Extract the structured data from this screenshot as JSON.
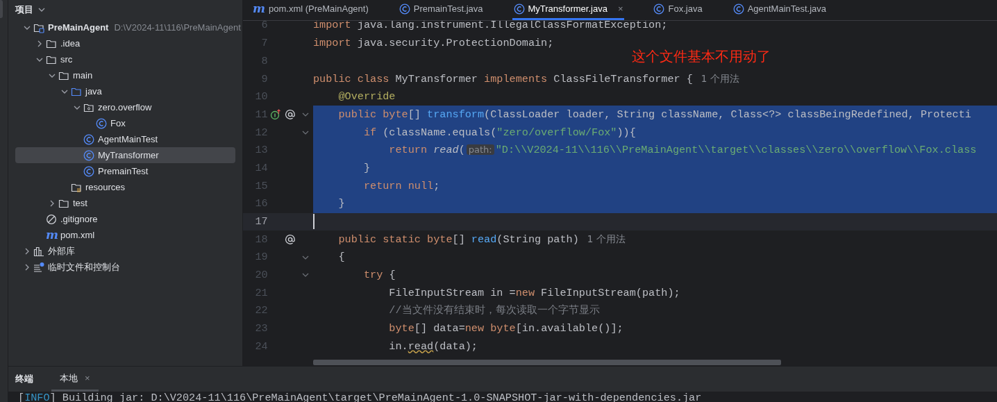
{
  "project_panel": {
    "title": "项目",
    "tree": [
      {
        "label": "PreMainAgent",
        "kind": "project",
        "path": "D:\\V2024-11\\116\\PreMainAgent",
        "expanded": true,
        "selected": false,
        "children": [
          {
            "label": ".idea",
            "kind": "folder",
            "expanded": false,
            "selected": false
          },
          {
            "label": "src",
            "kind": "folder",
            "expanded": true,
            "selected": false,
            "children": [
              {
                "label": "main",
                "kind": "folder",
                "expanded": true,
                "selected": false,
                "children": [
                  {
                    "label": "java",
                    "kind": "source",
                    "expanded": true,
                    "selected": false,
                    "children": [
                      {
                        "label": "zero.overflow",
                        "kind": "package",
                        "expanded": true,
                        "selected": false,
                        "children": [
                          {
                            "label": "Fox",
                            "kind": "class",
                            "selected": false
                          }
                        ]
                      },
                      {
                        "label": "AgentMainTest",
                        "kind": "class",
                        "selected": false
                      },
                      {
                        "label": "MyTransformer",
                        "kind": "class",
                        "selected": true
                      },
                      {
                        "label": "PremainTest",
                        "kind": "class",
                        "selected": false
                      }
                    ]
                  },
                  {
                    "label": "resources",
                    "kind": "resources",
                    "selected": false
                  }
                ]
              },
              {
                "label": "test",
                "kind": "folder",
                "expanded": false,
                "selected": false
              }
            ]
          },
          {
            "label": ".gitignore",
            "kind": "ignore",
            "selected": false
          },
          {
            "label": "pom.xml",
            "kind": "maven",
            "badge": "m",
            "selected": false
          }
        ]
      },
      {
        "label": "外部库",
        "kind": "library",
        "expanded": false,
        "selected": false
      },
      {
        "label": "临时文件和控制台",
        "kind": "scratch",
        "expanded": false,
        "selected": false
      }
    ]
  },
  "tabs": [
    {
      "label": "pom.xml (PreMainAgent)",
      "kind": "maven",
      "badge": "m",
      "selected": false
    },
    {
      "label": "PremainTest.java",
      "kind": "class",
      "selected": false
    },
    {
      "label": "MyTransformer.java",
      "kind": "class",
      "selected": true,
      "close": "×"
    },
    {
      "label": "Fox.java",
      "kind": "class",
      "selected": false
    },
    {
      "label": "AgentMainTest.java",
      "kind": "class",
      "selected": false
    }
  ],
  "note": "这个文件基本不用动了",
  "code_lines": [
    {
      "number": "6",
      "selected": false,
      "current": false,
      "override_mark": false,
      "usages_mark": false,
      "foldable": false,
      "tokens": [
        {
          "kind": "keyword",
          "text": "import"
        },
        {
          "kind": "plain",
          "text": " java.lang.instrument.IllegalClassFormatException;"
        }
      ]
    },
    {
      "number": "7",
      "selected": false,
      "current": false,
      "override_mark": false,
      "usages_mark": false,
      "foldable": false,
      "tokens": [
        {
          "kind": "keyword",
          "text": "import"
        },
        {
          "kind": "plain",
          "text": " java.security.ProtectionDomain;"
        }
      ]
    },
    {
      "number": "8",
      "selected": false,
      "current": false,
      "override_mark": false,
      "usages_mark": false,
      "foldable": false
    },
    {
      "number": "9",
      "selected": false,
      "current": false,
      "override_mark": false,
      "usages_mark": false,
      "foldable": false,
      "tokens": [
        {
          "kind": "keyword",
          "text": "public class"
        },
        {
          "kind": "plain",
          "text": " MyTransformer "
        },
        {
          "kind": "keyword",
          "text": "implements"
        },
        {
          "kind": "plain",
          "text": " ClassFileTransformer {"
        },
        {
          "kind": "usage",
          "text": "1 个用法"
        }
      ]
    },
    {
      "number": "10",
      "selected": false,
      "current": false,
      "override_mark": false,
      "usages_mark": false,
      "foldable": false,
      "tokens": [
        {
          "kind": "annotation",
          "text": "    @Override"
        }
      ]
    },
    {
      "number": "11",
      "selected": true,
      "current": false,
      "override_mark": true,
      "usages_mark": true,
      "foldable": true,
      "tokens": [
        {
          "kind": "keyword",
          "text": "    public byte"
        },
        {
          "kind": "plain",
          "text": "[] "
        },
        {
          "kind": "method",
          "text": "transform"
        },
        {
          "kind": "plain",
          "text": "(ClassLoader loader, String className, Class<?> classBeingRedefined, Protecti"
        }
      ]
    },
    {
      "number": "12",
      "selected": true,
      "current": false,
      "override_mark": false,
      "usages_mark": false,
      "foldable": true,
      "tokens": [
        {
          "kind": "keyword",
          "text": "        if"
        },
        {
          "kind": "plain",
          "text": " (className.equals("
        },
        {
          "kind": "string",
          "text": "\"zero/overflow/Fox\""
        },
        {
          "kind": "plain",
          "text": ")){"
        }
      ]
    },
    {
      "number": "13",
      "selected": true,
      "current": false,
      "override_mark": false,
      "usages_mark": false,
      "foldable": false,
      "tokens": [
        {
          "kind": "keyword",
          "text": "            return "
        },
        {
          "kind": "call",
          "text": "read"
        },
        {
          "kind": "plain",
          "text": "("
        },
        {
          "kind": "hint",
          "text": "path:"
        },
        {
          "kind": "string",
          "text": "\"D:\\\\V2024-11\\\\116\\\\PreMainAgent\\\\target\\\\classes\\\\zero\\\\overflow\\\\Fox.class"
        }
      ]
    },
    {
      "number": "14",
      "selected": true,
      "current": false,
      "override_mark": false,
      "usages_mark": false,
      "foldable": false,
      "tokens": [
        {
          "kind": "plain",
          "text": "        }"
        }
      ]
    },
    {
      "number": "15",
      "selected": true,
      "current": false,
      "override_mark": false,
      "usages_mark": false,
      "foldable": false,
      "tokens": [
        {
          "kind": "keyword",
          "text": "        return null"
        },
        {
          "kind": "plain",
          "text": ";"
        }
      ]
    },
    {
      "number": "16",
      "selected": true,
      "current": false,
      "override_mark": false,
      "usages_mark": false,
      "foldable": false,
      "tokens": [
        {
          "kind": "plain",
          "text": "    }"
        }
      ]
    },
    {
      "number": "17",
      "selected": false,
      "current": true,
      "override_mark": false,
      "usages_mark": false,
      "foldable": false
    },
    {
      "number": "18",
      "selected": false,
      "current": false,
      "override_mark": false,
      "usages_mark": true,
      "foldable": false,
      "tokens": [
        {
          "kind": "keyword",
          "text": "    public static byte"
        },
        {
          "kind": "plain",
          "text": "[] "
        },
        {
          "kind": "method",
          "text": "read"
        },
        {
          "kind": "plain",
          "text": "(String path)"
        },
        {
          "kind": "usage",
          "text": "1 个用法"
        }
      ]
    },
    {
      "number": "19",
      "selected": false,
      "current": false,
      "override_mark": false,
      "usages_mark": false,
      "foldable": true,
      "tokens": [
        {
          "kind": "plain",
          "text": "    {"
        }
      ]
    },
    {
      "number": "20",
      "selected": false,
      "current": false,
      "override_mark": false,
      "usages_mark": false,
      "foldable": true,
      "tokens": [
        {
          "kind": "keyword",
          "text": "        try"
        },
        {
          "kind": "plain",
          "text": " {"
        }
      ]
    },
    {
      "number": "21",
      "selected": false,
      "current": false,
      "override_mark": false,
      "usages_mark": false,
      "foldable": false,
      "tokens": [
        {
          "kind": "plain",
          "text": "            FileInputStream in ="
        },
        {
          "kind": "keyword",
          "text": "new"
        },
        {
          "kind": "plain",
          "text": " FileInputStream(path);"
        }
      ]
    },
    {
      "number": "22",
      "selected": false,
      "current": false,
      "override_mark": false,
      "usages_mark": false,
      "foldable": false,
      "tokens": [
        {
          "kind": "comment",
          "text": "            //当文件没有结束时，每次读取一个字节显示"
        }
      ]
    },
    {
      "number": "23",
      "selected": false,
      "current": false,
      "override_mark": false,
      "usages_mark": false,
      "foldable": false,
      "tokens": [
        {
          "kind": "keyword",
          "text": "            byte"
        },
        {
          "kind": "plain",
          "text": "[] data="
        },
        {
          "kind": "keyword",
          "text": "new byte"
        },
        {
          "kind": "plain",
          "text": "[in.available()];"
        }
      ]
    },
    {
      "number": "24",
      "selected": false,
      "current": false,
      "override_mark": false,
      "usages_mark": false,
      "foldable": false,
      "tokens": [
        {
          "kind": "plain",
          "text": "            in."
        },
        {
          "kind": "warning",
          "text": "read"
        },
        {
          "kind": "plain",
          "text": "(data);"
        }
      ]
    }
  ],
  "bottom_panel": {
    "title": "终端",
    "tabs": [
      {
        "label": "本地",
        "selected": true,
        "close": "×"
      }
    ],
    "output": [
      {
        "kind": "plain",
        "text": "["
      },
      {
        "kind": "info",
        "text": "INFO"
      },
      {
        "kind": "plain",
        "text": "] Building jar: D:\\V2024-11\\116\\PreMainAgent\\target\\PreMainAgent-1.0-SNAPSHOT-jar-with-dependencies.jar"
      }
    ]
  }
}
